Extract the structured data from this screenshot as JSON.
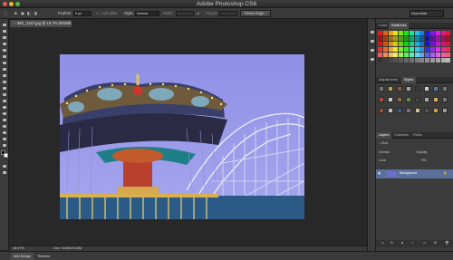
{
  "titlebar": {
    "title": "Adobe Photoshop CS6"
  },
  "options_bar": {
    "feather_label": "Feather:",
    "feather_value": "0 px",
    "anti_alias_label": "Anti-alias",
    "style_label": "Style:",
    "style_value": "Normal",
    "width_label": "Width:",
    "height_label": "Height:",
    "refine_edge_label": "Refine Edge...",
    "workspace_value": "Essentials"
  },
  "document": {
    "tab_label": "IMG_2157.jpg @ 16.7% (RGB/8)",
    "zoom": "16.67%",
    "doc_info": "Doc: 33.8M/33.8M"
  },
  "bottom_tabs": [
    "Mini Bridge",
    "Timeline"
  ],
  "panels": {
    "color_tabs": [
      "Color",
      "Swatches"
    ],
    "adjust_tabs": [
      "Adjustments",
      "Styles"
    ],
    "layer_tabs": [
      "Layers",
      "Channels",
      "Paths"
    ],
    "kind_label": "Kind",
    "blend_mode": "Normal",
    "opacity_label": "Opacity:",
    "lock_label": "Lock:",
    "fill_label": "Fill:",
    "layer_name": "Background"
  },
  "colors": {
    "sky": "#8f8fe6",
    "accent": "#5a6f99"
  }
}
